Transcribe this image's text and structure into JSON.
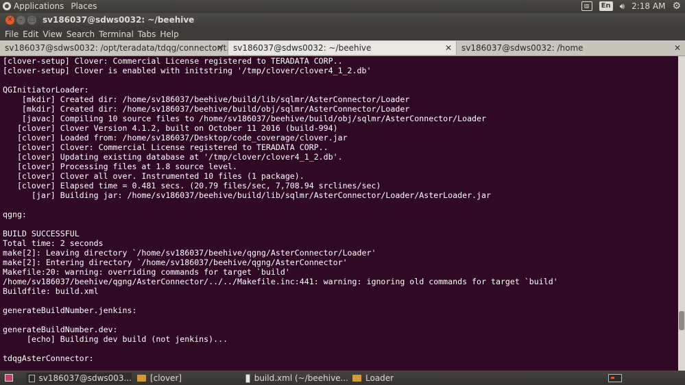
{
  "top_panel": {
    "applications": "Applications",
    "places": "Places",
    "lang": "En",
    "time": "2:18 AM"
  },
  "window": {
    "title": "sv186037@sdws0032: ~/beehive"
  },
  "menu": [
    "File",
    "Edit",
    "View",
    "Search",
    "Terminal",
    "Tabs",
    "Help"
  ],
  "tabs": [
    {
      "label": "sv186037@sdws0032: /opt/teradata/tdqg/connector/t..."
    },
    {
      "label": "sv186037@sdws0032: ~/beehive"
    },
    {
      "label": "sv186037@sdws0032: /home"
    }
  ],
  "terminal": {
    "text": "[clover-setup] Clover: Commercial License registered to TERADATA CORP..\n[clover-setup] Clover is enabled with initstring '/tmp/clover/clover4_1_2.db'\n\nQGInitiatorLoader:\n    [mkdir] Created dir: /home/sv186037/beehive/build/lib/sqlmr/AsterConnector/Loader\n    [mkdir] Created dir: /home/sv186037/beehive/build/obj/sqlmr/AsterConnector/Loader\n    [javac] Compiling 10 source files to /home/sv186037/beehive/build/obj/sqlmr/AsterConnector/Loader\n   [clover] Clover Version 4.1.2, built on October 11 2016 (build-994)\n   [clover] Loaded from: /home/sv186037/Desktop/code_coverage/clover.jar\n   [clover] Clover: Commercial License registered to TERADATA CORP..\n   [clover] Updating existing database at '/tmp/clover/clover4_1_2.db'.\n   [clover] Processing files at 1.8 source level.\n   [clover] Clover all over. Instrumented 10 files (1 package).\n   [clover] Elapsed time = 0.481 secs. (20.79 files/sec, 7,708.94 srclines/sec)\n      [jar] Building jar: /home/sv186037/beehive/build/lib/sqlmr/AsterConnector/Loader/AsterLoader.jar\n\nqgng:\n\nBUILD SUCCESSFUL\nTotal time: 2 seconds\nmake[2]: Leaving directory `/home/sv186037/beehive/qgng/AsterConnector/Loader'\nmake[2]: Entering directory `/home/sv186037/beehive/qgng/AsterConnector'\nMakefile:20: warning: overriding commands for target `build'\n/home/sv186037/beehive/qgng/AsterConnector/../../Makefile.inc:441: warning: ignoring old commands for target `build'\nBuildfile: build.xml\n\ngenerateBuildNumber.jenkins:\n\ngenerateBuildNumber.dev:\n     [echo] Building dev build (not jenkins)...\n\ntdqgAsterConnector:"
  },
  "taskbar": [
    {
      "label": "sv186037@sdws003...",
      "icon": "terminal-icon"
    },
    {
      "label": "[clover]",
      "icon": "folder-icon"
    },
    {
      "label": "build.xml (~/beehive...",
      "icon": "file-icon"
    },
    {
      "label": "Loader",
      "icon": "folder-icon"
    }
  ],
  "colors": {
    "terminal_bg": "#300a24",
    "terminal_fg": "#ffffff",
    "close_button": "#e05a2b"
  }
}
